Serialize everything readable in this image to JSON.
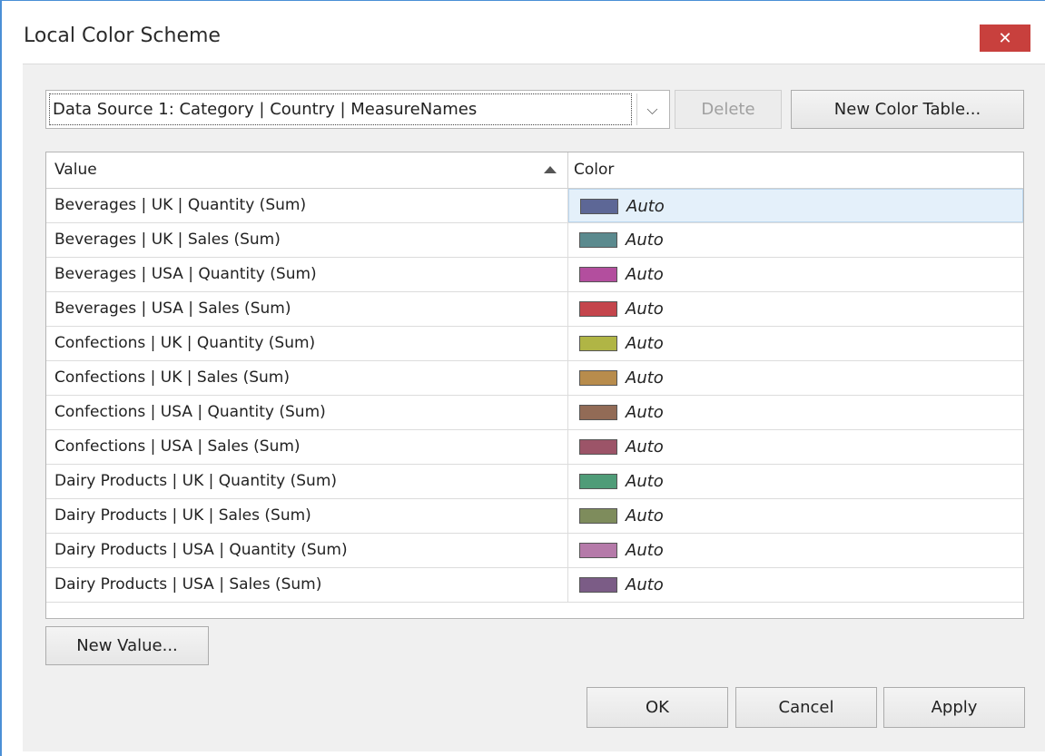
{
  "window": {
    "title": "Local Color Scheme",
    "close_glyph": "✕"
  },
  "toolbar": {
    "scheme_select_value": "Data Source 1: Category | Country | MeasureNames",
    "dropdown_glyph": "⌵",
    "delete_label": "Delete",
    "new_color_table_label": "New Color Table..."
  },
  "grid": {
    "columns": {
      "value": "Value",
      "color": "Color"
    },
    "sort": "ascending",
    "rows": [
      {
        "value": "Beverages | UK | Quantity (Sum)",
        "color": "#5d6796",
        "color_label": "Auto"
      },
      {
        "value": "Beverages | UK | Sales (Sum)",
        "color": "#5b8a8e",
        "color_label": "Auto"
      },
      {
        "value": "Beverages | USA | Quantity (Sum)",
        "color": "#b34e9e",
        "color_label": "Auto"
      },
      {
        "value": "Beverages | USA | Sales (Sum)",
        "color": "#c4454c",
        "color_label": "Auto"
      },
      {
        "value": "Confections | UK | Quantity (Sum)",
        "color": "#b0b545",
        "color_label": "Auto"
      },
      {
        "value": "Confections | UK | Sales (Sum)",
        "color": "#b88c4c",
        "color_label": "Auto"
      },
      {
        "value": "Confections | USA | Quantity (Sum)",
        "color": "#926b56",
        "color_label": "Auto"
      },
      {
        "value": "Confections | USA | Sales (Sum)",
        "color": "#9c5468",
        "color_label": "Auto"
      },
      {
        "value": "Dairy Products | UK | Quantity (Sum)",
        "color": "#4f9c78",
        "color_label": "Auto"
      },
      {
        "value": "Dairy Products | UK | Sales (Sum)",
        "color": "#7e8c5c",
        "color_label": "Auto"
      },
      {
        "value": "Dairy Products | USA | Quantity (Sum)",
        "color": "#b57aa9",
        "color_label": "Auto"
      },
      {
        "value": "Dairy Products | USA | Sales (Sum)",
        "color": "#7b5c86",
        "color_label": "Auto"
      }
    ]
  },
  "actions": {
    "new_value_label": "New Value...",
    "ok_label": "OK",
    "cancel_label": "Cancel",
    "apply_label": "Apply"
  },
  "colors": {
    "accent": "#4a8fd6",
    "close": "#c8403d",
    "selection": "#e4f0fa"
  }
}
